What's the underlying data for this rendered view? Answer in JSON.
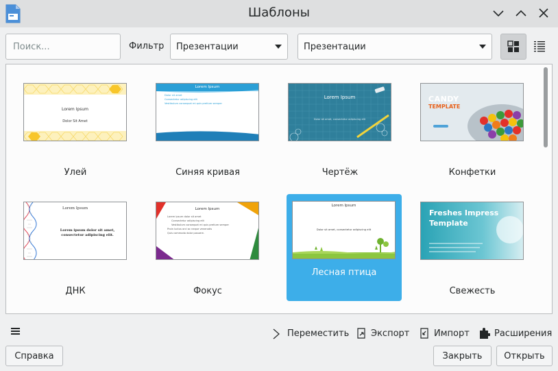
{
  "window": {
    "title": "Шаблоны"
  },
  "toolbar": {
    "search_placeholder": "Поиск...",
    "filter_label": "Фильтр",
    "combo1_value": "Презентации",
    "combo2_value": "Презентации"
  },
  "templates": [
    {
      "label": "Улей",
      "thumb_title": "Lorem Ipsum",
      "thumb_sub": "Dolor Sit Amet"
    },
    {
      "label": "Синяя кривая",
      "thumb_title": "Lorem Ipsum",
      "thumb_lines": [
        "Dolor sit amet",
        "Consectetur adipiscing elit",
        "Vestibulum consequat mi quis pretium semper"
      ]
    },
    {
      "label": "Чертёж",
      "thumb_title": "Lorem Ipsum",
      "thumb_sub": "Dolor sit amet, consectetur adipiscing elit"
    },
    {
      "label": "Конфетки",
      "thumb_title": "CANDY",
      "thumb_sub": "TEMPLATE"
    },
    {
      "label": "ДНК",
      "thumb_title": "Lorem Ipsum",
      "thumb_sub": "Lorem ipsum dolor sit amet, consectetur adipiscing elit."
    },
    {
      "label": "Фокус",
      "thumb_title": "Lorem Ipsum",
      "thumb_lines": [
        "Lorem ipsum dolor sit amet",
        "Consectetur adipiscing elit",
        "Vestibulum consequat mi quis pretium semper",
        "Proin luctus orci ac neque venenatis",
        "Quis commodo dolor posuere."
      ]
    },
    {
      "label": "Лесная птица",
      "thumb_title": "Lorem Ipsum",
      "thumb_sub": "Dolor sit amet, consectetur adipiscing elit"
    },
    {
      "label": "Свежесть",
      "thumb_title": "Freshes Impress Template"
    }
  ],
  "actions": {
    "move": "Переместить",
    "export": "Экспорт",
    "import": "Импорт",
    "extensions": "Расширения"
  },
  "buttons": {
    "help": "Справка",
    "close": "Закрыть",
    "open": "Открыть"
  }
}
